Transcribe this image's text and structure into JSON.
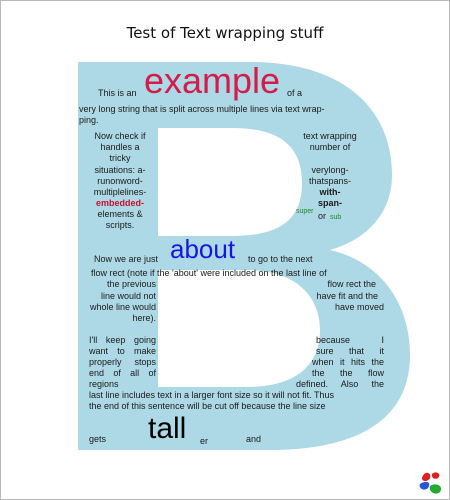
{
  "title": "Test of Text wrapping stuff",
  "colors": {
    "b_fill": "#add8e6",
    "example_word": "#d41c4a",
    "about_word": "#1515e6",
    "embedded_word": "#c8102e",
    "super_sub": "#1e8c1e"
  },
  "top_block": {
    "lead": "This is an",
    "highlight": "example",
    "trail": "of a",
    "line2": "very long string that is split across multiple lines via text wrap-",
    "line3": "ping."
  },
  "left_column": {
    "l1": "Now check if",
    "l2": "handles a",
    "l3": "tricky",
    "l4": "situations: a-",
    "l5": "runonword-",
    "l6": "multiplelines-",
    "l7_bold": "embedded-",
    "l8": "elements &",
    "l9": "scripts."
  },
  "right_column": {
    "l1": "text wrapping",
    "l2": "number of",
    "l3": "verylong-",
    "l4": "thatspans-",
    "l5_bold": "with-",
    "l6_bold": "span-",
    "super": "super",
    "or": "or",
    "sub": "sub"
  },
  "middle_block": {
    "lead": "Now we are just",
    "highlight": "about",
    "trail": "to go to the next",
    "l2": "flow rect (note if the 'about' were included on the last line of",
    "l3_left": "the previous",
    "l3_right": "flow rect the",
    "l4_left": "line would not",
    "l4_right": "have fit and the",
    "l5_left": "whole line would",
    "l5_right": "have moved",
    "l6_left": "here)."
  },
  "bottom_block": {
    "l1_left": "I'll keep going",
    "l1_right": "because I",
    "l2_left": "want to make",
    "l2_right": "sure that it",
    "l3_left": "properly stops",
    "l3_right": "when it hits the",
    "l4_left": "end of all of",
    "l4_right": "the the flow",
    "l5_left": "regions",
    "l5_right": "defined. Also the",
    "l6": "last line includes text in a larger font size so it will not fit. Thus",
    "l7": "the end of this sentence will be cut off because the line size",
    "l8_gets": "gets",
    "l8_tall": "tall",
    "l8_er": "er",
    "l8_and": "and"
  }
}
